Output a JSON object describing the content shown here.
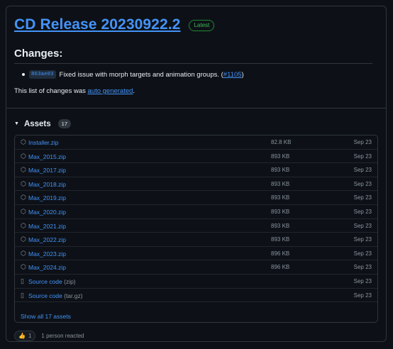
{
  "release": {
    "title": "CD Release 20230922.2",
    "badge": "Latest"
  },
  "changes": {
    "heading": "Changes:",
    "items": [
      {
        "sha": "863ae03",
        "text": "Fixed issue with morph targets and animation groups. (",
        "pr": "#1105",
        "close": ")"
      }
    ],
    "note_prefix": "This list of changes was ",
    "note_link": "auto generated",
    "note_suffix": "."
  },
  "assets": {
    "heading": "Assets",
    "count": "17",
    "rows": [
      {
        "icon": "package-icon",
        "name": "Installer.zip",
        "size": "82.8 KB",
        "date": "Sep 23"
      },
      {
        "icon": "package-icon",
        "name": "Max_2015.zip",
        "size": "893 KB",
        "date": "Sep 23"
      },
      {
        "icon": "package-icon",
        "name": "Max_2017.zip",
        "size": "893 KB",
        "date": "Sep 23"
      },
      {
        "icon": "package-icon",
        "name": "Max_2018.zip",
        "size": "893 KB",
        "date": "Sep 23"
      },
      {
        "icon": "package-icon",
        "name": "Max_2019.zip",
        "size": "893 KB",
        "date": "Sep 23"
      },
      {
        "icon": "package-icon",
        "name": "Max_2020.zip",
        "size": "893 KB",
        "date": "Sep 23"
      },
      {
        "icon": "package-icon",
        "name": "Max_2021.zip",
        "size": "893 KB",
        "date": "Sep 23"
      },
      {
        "icon": "package-icon",
        "name": "Max_2022.zip",
        "size": "893 KB",
        "date": "Sep 23"
      },
      {
        "icon": "package-icon",
        "name": "Max_2023.zip",
        "size": "896 KB",
        "date": "Sep 23"
      },
      {
        "icon": "package-icon",
        "name": "Max_2024.zip",
        "size": "896 KB",
        "date": "Sep 23"
      },
      {
        "icon": "file-zip-icon",
        "name": "Source code",
        "sub": "(zip)",
        "size": "",
        "date": "Sep 23"
      },
      {
        "icon": "file-zip-icon",
        "name": "Source code",
        "sub": "(tar.gz)",
        "size": "",
        "date": "Sep 23"
      }
    ],
    "show_all": "Show all 17 assets"
  },
  "reactions": {
    "emoji": "👍",
    "count": "1",
    "text": "1 person reacted"
  }
}
